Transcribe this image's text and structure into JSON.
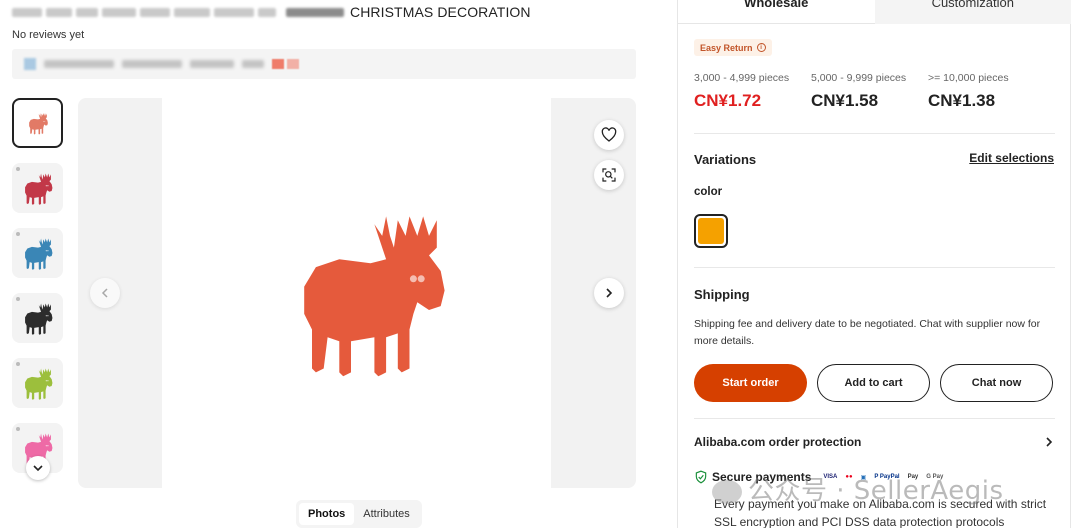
{
  "product": {
    "title_visible": "CHRISTMAS DECORATION",
    "reviews": "No reviews yet"
  },
  "gallery": {
    "thumbnails": [
      {
        "name": "thumb-red-small",
        "color": "#e27a66"
      },
      {
        "name": "thumb-crimson",
        "color": "#c23848"
      },
      {
        "name": "thumb-blue",
        "color": "#3a86b6"
      },
      {
        "name": "thumb-black",
        "color": "#2c2c2c"
      },
      {
        "name": "thumb-lime",
        "color": "#9cbf3c"
      },
      {
        "name": "thumb-pink",
        "color": "#ee6aa6"
      }
    ],
    "main_image_color": "#e55a3c",
    "view_tabs": [
      "Photos",
      "Attributes"
    ]
  },
  "panel": {
    "tabs": [
      "Wholesale",
      "Customization"
    ],
    "easy_return": "Easy Return",
    "price_tiers": [
      {
        "range": "3,000 - 4,999 pieces",
        "price": "CN¥1.72",
        "highlight": true
      },
      {
        "range": "5,000 - 9,999 pieces",
        "price": "CN¥1.58",
        "highlight": false
      },
      {
        "range": ">= 10,000 pieces",
        "price": "CN¥1.38",
        "highlight": false
      }
    ],
    "variations": {
      "title": "Variations",
      "edit_link": "Edit selections",
      "attribute": "color",
      "selected_swatch": "#f5a100"
    },
    "shipping": {
      "title": "Shipping",
      "text": "Shipping fee and delivery date to be negotiated. Chat with supplier now for more details."
    },
    "buttons": {
      "start_order": "Start order",
      "add_to_cart": "Add to cart",
      "chat_now": "Chat now"
    },
    "protection": {
      "title": "Alibaba.com order protection",
      "secure_title": "Secure payments",
      "secure_text": "Every payment you make on Alibaba.com is secured with strict SSL encryption and PCI DSS data protection protocols"
    },
    "payment_logos": [
      "VISA",
      "●●",
      "▣",
      "P PayPal",
      "Pay",
      "G Pay"
    ]
  },
  "watermark": "公众号 · SellerAegis",
  "colors": {
    "accent": "#d64000",
    "price_red": "#e02020",
    "easy_return_text": "#c2552a"
  }
}
